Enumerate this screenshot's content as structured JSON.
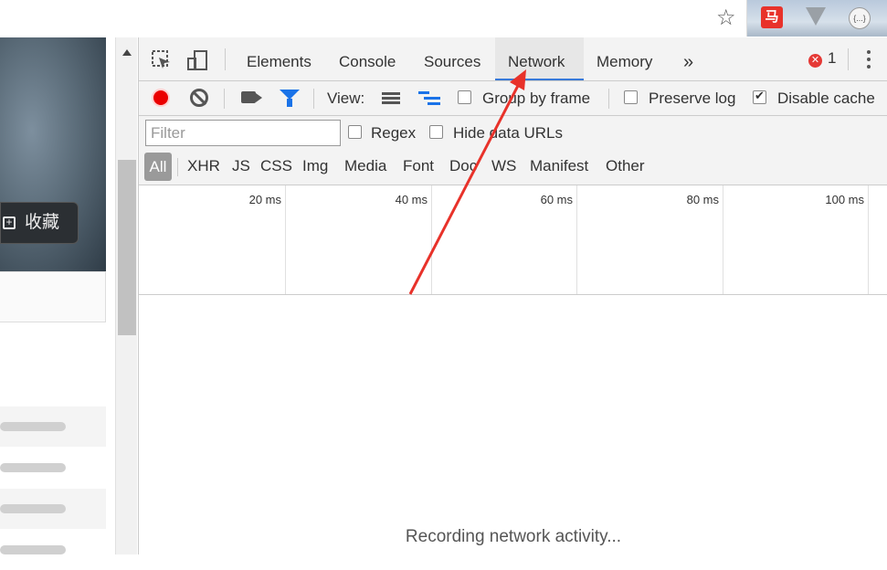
{
  "browser": {
    "star_icon": "☆",
    "extensions": [
      {
        "name": "red-extension",
        "text": "马"
      },
      {
        "name": "gray-extension",
        "text": ""
      },
      {
        "name": "json-extension",
        "text": "{...}"
      }
    ]
  },
  "page": {
    "collect_label": "收藏"
  },
  "devtools": {
    "tabs": [
      "Elements",
      "Console",
      "Sources",
      "Network",
      "Memory"
    ],
    "more_tabs": "»",
    "active_tab": "Network",
    "error_count": "1",
    "error_icon": "✕",
    "toolbar": {
      "view_label": "View:",
      "group_by_frame": "Group by frame",
      "preserve_log": "Preserve log",
      "disable_cache": "Disable cache",
      "group_by_frame_checked": false,
      "preserve_log_checked": false,
      "disable_cache_checked": true
    },
    "filter": {
      "placeholder": "Filter",
      "value": "",
      "regex": "Regex",
      "hide_data_urls": "Hide data URLs"
    },
    "types": [
      "All",
      "XHR",
      "JS",
      "CSS",
      "Img",
      "Media",
      "Font",
      "Doc",
      "WS",
      "Manifest",
      "Other"
    ],
    "ticks": [
      "20 ms",
      "40 ms",
      "60 ms",
      "80 ms",
      "100 ms"
    ],
    "status_text": "Recording network activity...",
    "colors": {
      "record": "#ea0000",
      "accent": "#1a73e8",
      "active_underline": "#3879d9",
      "annotation_arrow": "#e8322a"
    }
  }
}
